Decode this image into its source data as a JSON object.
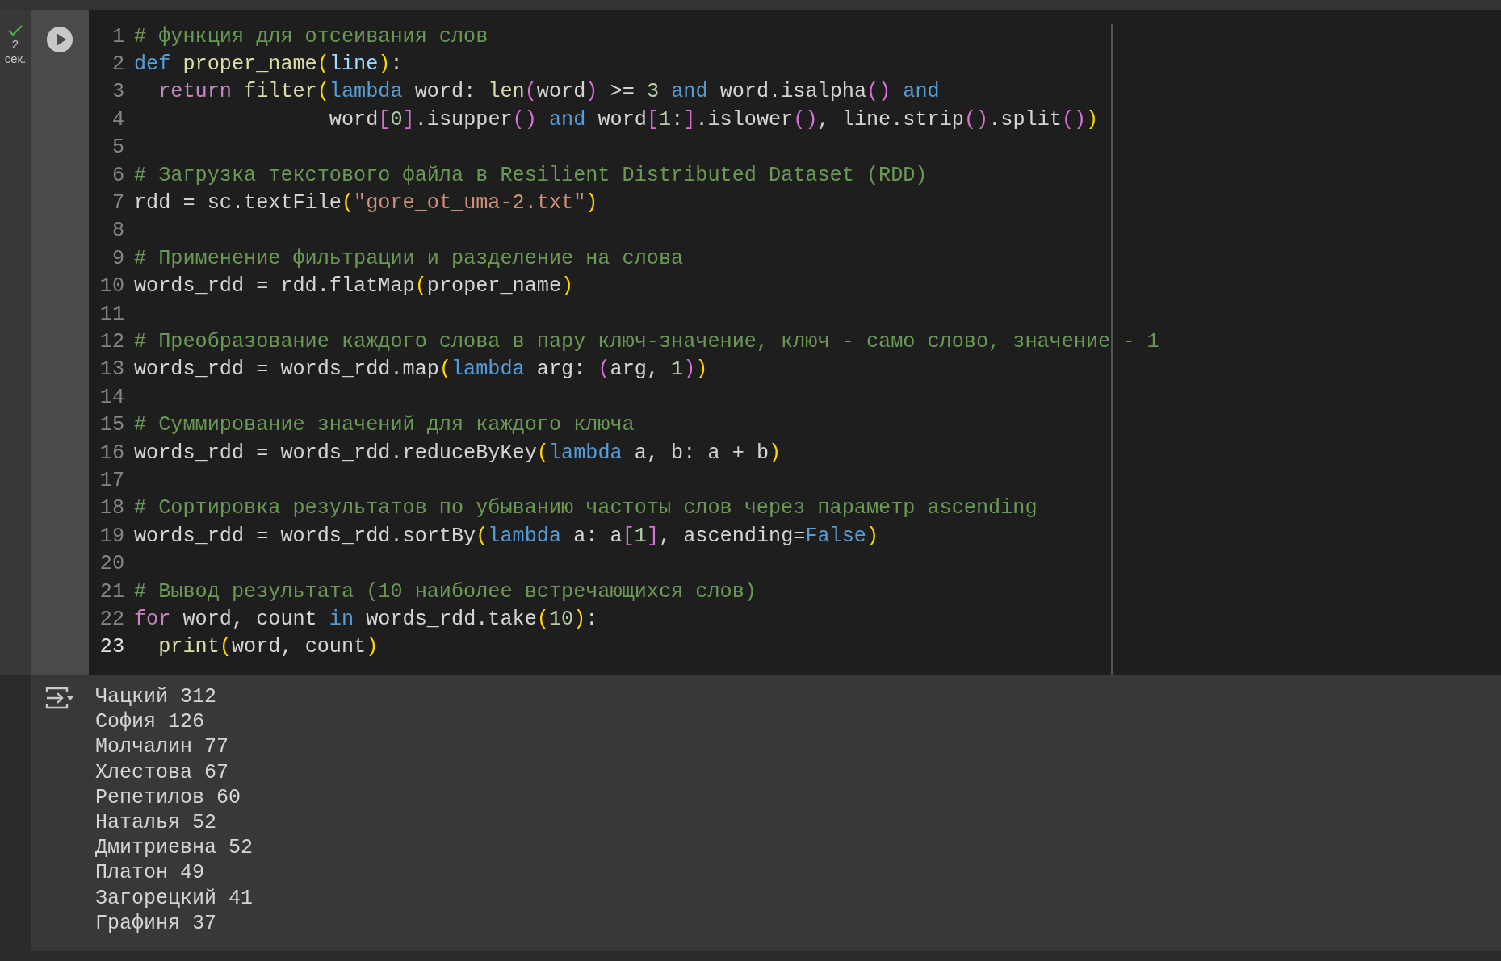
{
  "cell_status": {
    "done": true,
    "duration_value": "2",
    "duration_unit": "сек."
  },
  "code_lines": [
    {
      "number": "1",
      "active": false,
      "tokens": [
        {
          "kind": "comment",
          "text": "# функция для отсеивания слов"
        }
      ]
    },
    {
      "number": "2",
      "active": false,
      "tokens": [
        {
          "kind": "keyword",
          "text": "def"
        },
        {
          "kind": "func",
          "text": " proper_name"
        },
        {
          "kind": "bracket1",
          "text": "("
        },
        {
          "kind": "param",
          "text": "line"
        },
        {
          "kind": "bracket1",
          "text": ")"
        },
        {
          "kind": "plain",
          "text": ":"
        }
      ]
    },
    {
      "number": "3",
      "active": false,
      "tokens": [
        {
          "kind": "control",
          "text": "  return"
        },
        {
          "kind": "func",
          "text": " filter"
        },
        {
          "kind": "bracket1",
          "text": "("
        },
        {
          "kind": "keyword",
          "text": "lambda"
        },
        {
          "kind": "plain",
          "text": " word: "
        },
        {
          "kind": "func",
          "text": "len"
        },
        {
          "kind": "bracket2",
          "text": "("
        },
        {
          "kind": "plain",
          "text": "word"
        },
        {
          "kind": "bracket2",
          "text": ")"
        },
        {
          "kind": "plain",
          "text": " >= "
        },
        {
          "kind": "number",
          "text": "3"
        },
        {
          "kind": "keyword",
          "text": " and"
        },
        {
          "kind": "plain",
          "text": " word.isalpha"
        },
        {
          "kind": "bracket2",
          "text": "()"
        },
        {
          "kind": "keyword",
          "text": " and"
        }
      ]
    },
    {
      "number": "4",
      "active": false,
      "tokens": [
        {
          "kind": "plain",
          "text": "                word"
        },
        {
          "kind": "bracket2",
          "text": "["
        },
        {
          "kind": "number",
          "text": "0"
        },
        {
          "kind": "bracket2",
          "text": "]"
        },
        {
          "kind": "plain",
          "text": ".isupper"
        },
        {
          "kind": "bracket2",
          "text": "()"
        },
        {
          "kind": "keyword",
          "text": " and"
        },
        {
          "kind": "plain",
          "text": " word"
        },
        {
          "kind": "bracket2",
          "text": "["
        },
        {
          "kind": "number",
          "text": "1"
        },
        {
          "kind": "plain",
          "text": ":"
        },
        {
          "kind": "bracket2",
          "text": "]"
        },
        {
          "kind": "plain",
          "text": ".islower"
        },
        {
          "kind": "bracket2",
          "text": "()"
        },
        {
          "kind": "plain",
          "text": ", line.strip"
        },
        {
          "kind": "bracket2",
          "text": "()"
        },
        {
          "kind": "plain",
          "text": ".split"
        },
        {
          "kind": "bracket2",
          "text": "()"
        },
        {
          "kind": "bracket1",
          "text": ")"
        }
      ]
    },
    {
      "number": "5",
      "active": false
    },
    {
      "number": "6",
      "active": false,
      "tokens": [
        {
          "kind": "comment",
          "text": "# Загрузка текстового файла в Resilient Distributed Dataset (RDD)"
        }
      ]
    },
    {
      "number": "7",
      "active": false,
      "tokens": [
        {
          "kind": "plain",
          "text": "rdd = sc.textFile"
        },
        {
          "kind": "bracket1",
          "text": "("
        },
        {
          "kind": "string",
          "text": "\"gore_ot_uma-2.txt\""
        },
        {
          "kind": "bracket1",
          "text": ")"
        }
      ]
    },
    {
      "number": "8",
      "active": false
    },
    {
      "number": "9",
      "active": false,
      "tokens": [
        {
          "kind": "comment",
          "text": "# Применение фильтрации и разделение на слова"
        }
      ]
    },
    {
      "number": "10",
      "active": false,
      "tokens": [
        {
          "kind": "plain",
          "text": "words_rdd = rdd.flatMap"
        },
        {
          "kind": "bracket1",
          "text": "("
        },
        {
          "kind": "plain",
          "text": "proper_name"
        },
        {
          "kind": "bracket1",
          "text": ")"
        }
      ]
    },
    {
      "number": "11",
      "active": false
    },
    {
      "number": "12",
      "active": false,
      "tokens": [
        {
          "kind": "comment",
          "text": "# Преобразование каждого слова в пару ключ-значение, ключ - само слово, значение - 1"
        }
      ]
    },
    {
      "number": "13",
      "active": false,
      "tokens": [
        {
          "kind": "plain",
          "text": "words_rdd = words_rdd.map"
        },
        {
          "kind": "bracket1",
          "text": "("
        },
        {
          "kind": "keyword",
          "text": "lambda"
        },
        {
          "kind": "plain",
          "text": " arg: "
        },
        {
          "kind": "bracket2",
          "text": "("
        },
        {
          "kind": "plain",
          "text": "arg, "
        },
        {
          "kind": "number",
          "text": "1"
        },
        {
          "kind": "bracket2",
          "text": ")"
        },
        {
          "kind": "bracket1",
          "text": ")"
        }
      ]
    },
    {
      "number": "14",
      "active": false
    },
    {
      "number": "15",
      "active": false,
      "tokens": [
        {
          "kind": "comment",
          "text": "# Суммирование значений для каждого ключа"
        }
      ]
    },
    {
      "number": "16",
      "active": false,
      "tokens": [
        {
          "kind": "plain",
          "text": "words_rdd = words_rdd.reduceByKey"
        },
        {
          "kind": "bracket1",
          "text": "("
        },
        {
          "kind": "keyword",
          "text": "lambda"
        },
        {
          "kind": "plain",
          "text": " a, b: a + b"
        },
        {
          "kind": "bracket1",
          "text": ")"
        }
      ]
    },
    {
      "number": "17",
      "active": false
    },
    {
      "number": "18",
      "active": false,
      "tokens": [
        {
          "kind": "comment",
          "text": "# Сортировка результатов по убыванию частоты слов через параметр ascending"
        }
      ]
    },
    {
      "number": "19",
      "active": false,
      "tokens": [
        {
          "kind": "plain",
          "text": "words_rdd = words_rdd.sortBy"
        },
        {
          "kind": "bracket1",
          "text": "("
        },
        {
          "kind": "keyword",
          "text": "lambda"
        },
        {
          "kind": "plain",
          "text": " a: a"
        },
        {
          "kind": "bracket2",
          "text": "["
        },
        {
          "kind": "number",
          "text": "1"
        },
        {
          "kind": "bracket2",
          "text": "]"
        },
        {
          "kind": "plain",
          "text": ", ascending="
        },
        {
          "kind": "keyword",
          "text": "False"
        },
        {
          "kind": "bracket1",
          "text": ")"
        }
      ]
    },
    {
      "number": "20",
      "active": false
    },
    {
      "number": "21",
      "active": false,
      "tokens": [
        {
          "kind": "comment",
          "text": "# Вывод результата (10 наиболее встречающихся слов)"
        }
      ]
    },
    {
      "number": "22",
      "active": false,
      "tokens": [
        {
          "kind": "control",
          "text": "for"
        },
        {
          "kind": "plain",
          "text": " word, count "
        },
        {
          "kind": "keyword",
          "text": "in"
        },
        {
          "kind": "plain",
          "text": " words_rdd.take"
        },
        {
          "kind": "bracket1",
          "text": "("
        },
        {
          "kind": "number",
          "text": "10"
        },
        {
          "kind": "bracket1",
          "text": ")"
        },
        {
          "kind": "plain",
          "text": ":"
        }
      ]
    },
    {
      "number": "23",
      "active": true,
      "tokens": [
        {
          "kind": "func",
          "text": "  print"
        },
        {
          "kind": "bracket1",
          "text": "("
        },
        {
          "kind": "plain",
          "text": "word, count"
        },
        {
          "kind": "bracket1",
          "text": ")"
        }
      ]
    }
  ],
  "output_lines": [
    "Чацкий 312",
    "София 126",
    "Молчалин 77",
    "Хлестова 67",
    "Репетилов 60",
    "Наталья 52",
    "Дмитриевна 52",
    "Платон 49",
    "Загорецкий 41",
    "Графиня 37"
  ]
}
